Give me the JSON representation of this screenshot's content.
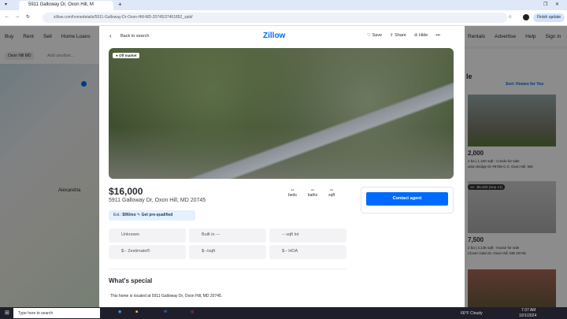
{
  "browser": {
    "tab_title": "5911 Galloway Dr, Oxon Hill, M",
    "url": "zillow.com/homedetails/5911-Galloway-Dr-Oxon-Hill-MD-20745/37461852_zpid/",
    "update_label": "Finish update"
  },
  "site_nav": {
    "left": [
      "Buy",
      "Rent",
      "Sell",
      "Home Loans"
    ],
    "right": [
      "Rentals",
      "Advertise",
      "Help",
      "Sign in"
    ]
  },
  "search": {
    "chip": "Oxon Hill MD",
    "placeholder": "Add another..."
  },
  "map": {
    "label": "Alexandria"
  },
  "listings_panel": {
    "heading": "le",
    "sort": "Sort: Homes for You",
    "cards": [
      {
        "badge": "",
        "price": "2,000",
        "line1": "2 ba | 1,100 sqft - Condo for sale",
        "line2": "ation Bridge Dr #6756-C-2, Oxon Hill, MD"
      },
      {
        "badge": "ce: -$5,000 (Sep 14)",
        "price": "7,500",
        "line1": "2 ba | 2,146 sqft - House for sale",
        "line2": "Clover Gate Dr, Oxon Hill, MD 20745"
      }
    ]
  },
  "modal": {
    "back": "Back to search",
    "logo": "Zillow",
    "save": "Save",
    "share": "Share",
    "hide": "Hide",
    "badge": "Off market",
    "price": "$16,000",
    "address": "5911 Galloway Dr, Oxon Hill, MD 20745",
    "stats": [
      {
        "v": "--",
        "l": "beds"
      },
      {
        "v": "--",
        "l": "baths"
      },
      {
        "v": "--",
        "l": "sqft"
      }
    ],
    "est_label": "Est.:",
    "est_value": "$96/mo",
    "prequal": "Get pre-qualified",
    "facts": [
      "Unknown",
      "Built in ---",
      "-- sqft lot",
      "$-- Zestimate®",
      "$--/sqft",
      "$-- HOA"
    ],
    "contact": "Contact agent",
    "special_title": "What's special",
    "description": "This home is located at 5911 Galloway Dr, Oxon Hill, MD 20745."
  },
  "taskbar": {
    "search": "Type here to search",
    "weather": "66°F Cloudy",
    "time": "7:37 AM",
    "date": "10/1/2024"
  },
  "colors": {
    "accent": "#006aff"
  }
}
